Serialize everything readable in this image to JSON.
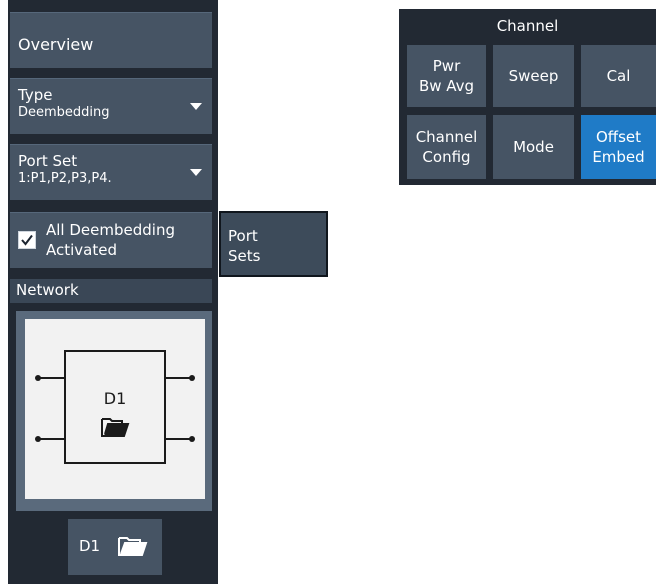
{
  "left_panel": {
    "overview_label": "Overview",
    "type": {
      "label": "Type",
      "value": "Deembedding"
    },
    "port_set": {
      "label": "Port Set",
      "value": "1:P1,P2,P3,P4."
    },
    "all_deembedding": {
      "line1": "All Deembedding",
      "line2": "Activated",
      "checked": true
    },
    "network_header": "Network",
    "network_diagram_label": "D1",
    "d1_button_label": "D1"
  },
  "submenu": {
    "line1": "Port",
    "line2": "Sets"
  },
  "channel": {
    "title": "Channel",
    "buttons": [
      {
        "line1": "Pwr",
        "line2": "Bw Avg"
      },
      {
        "line1": "Sweep"
      },
      {
        "line1": "Cal"
      },
      {
        "line1": "Channel",
        "line2": "Config"
      },
      {
        "line1": "Mode"
      },
      {
        "line1": "Offset",
        "line2": "Embed",
        "selected": true
      }
    ]
  },
  "colors": {
    "panel_bg": "#222933",
    "button_bg": "#465464",
    "selected_bg": "#1f7bc7"
  }
}
